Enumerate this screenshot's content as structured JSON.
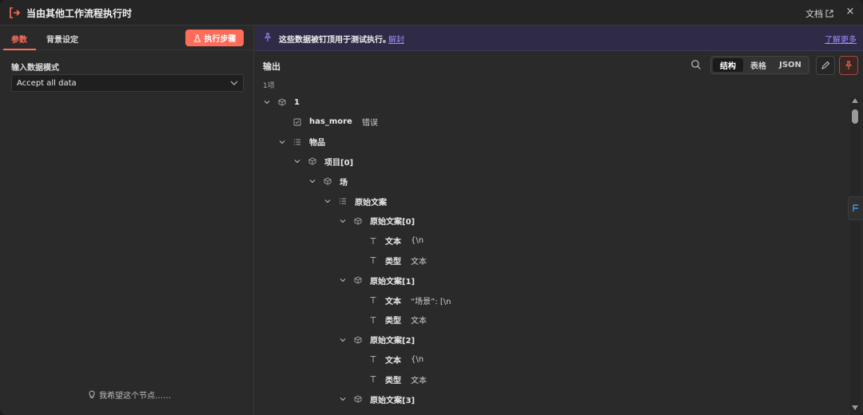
{
  "header": {
    "title": "当由其他工作流程执行时",
    "docs_label": "文档",
    "close_label": "×"
  },
  "left": {
    "tabs": [
      {
        "label": "参数",
        "active": true
      },
      {
        "label": "背景设定",
        "active": false
      }
    ],
    "exec_button": "执行步骤",
    "field_label": "输入数据模式",
    "select_value": "Accept all data",
    "hint": "我希望这个节点……"
  },
  "banner": {
    "text": "这些数据被钉顶用于测试执行。",
    "unpin_link": "解封",
    "learn_more": "了解更多"
  },
  "output": {
    "label": "输出",
    "count": "1项",
    "view_modes": [
      {
        "label": "结构",
        "active": true
      },
      {
        "label": "表格",
        "active": false
      },
      {
        "label": "JSON",
        "active": false
      }
    ]
  },
  "tree": [
    {
      "level": 0,
      "chevron": true,
      "icon": "cube",
      "key": "1",
      "value": ""
    },
    {
      "level": 1,
      "chevron": false,
      "icon": "boolean",
      "key": "has_more",
      "value": "错误"
    },
    {
      "level": 1,
      "chevron": true,
      "icon": "list",
      "key": "物品",
      "value": ""
    },
    {
      "level": 2,
      "chevron": true,
      "icon": "cube",
      "key": "项目[0]",
      "value": ""
    },
    {
      "level": 3,
      "chevron": true,
      "icon": "cube",
      "key": "场",
      "value": ""
    },
    {
      "level": 4,
      "chevron": true,
      "icon": "list",
      "key": "原始文案",
      "value": ""
    },
    {
      "level": 5,
      "chevron": true,
      "icon": "cube",
      "key": "原始文案[0]",
      "value": ""
    },
    {
      "level": 6,
      "chevron": false,
      "icon": "text",
      "key": "文本",
      "value": "{\\n"
    },
    {
      "level": 6,
      "chevron": false,
      "icon": "text",
      "key": "类型",
      "value": "文本"
    },
    {
      "level": 5,
      "chevron": true,
      "icon": "cube",
      "key": "原始文案[1]",
      "value": ""
    },
    {
      "level": 6,
      "chevron": false,
      "icon": "text",
      "key": "文本",
      "value": "“场景”: [\\n"
    },
    {
      "level": 6,
      "chevron": false,
      "icon": "text",
      "key": "类型",
      "value": "文本"
    },
    {
      "level": 5,
      "chevron": true,
      "icon": "cube",
      "key": "原始文案[2]",
      "value": ""
    },
    {
      "level": 6,
      "chevron": false,
      "icon": "text",
      "key": "文本",
      "value": "{\\n"
    },
    {
      "level": 6,
      "chevron": false,
      "icon": "text",
      "key": "类型",
      "value": "文本"
    },
    {
      "level": 5,
      "chevron": true,
      "icon": "cube",
      "key": "原始文案[3]",
      "value": ""
    }
  ],
  "colors": {
    "accent": "#ff6d5a",
    "banner_bg": "#2f2b47",
    "link": "#9f8cff",
    "panel": "#2a2a2a"
  }
}
